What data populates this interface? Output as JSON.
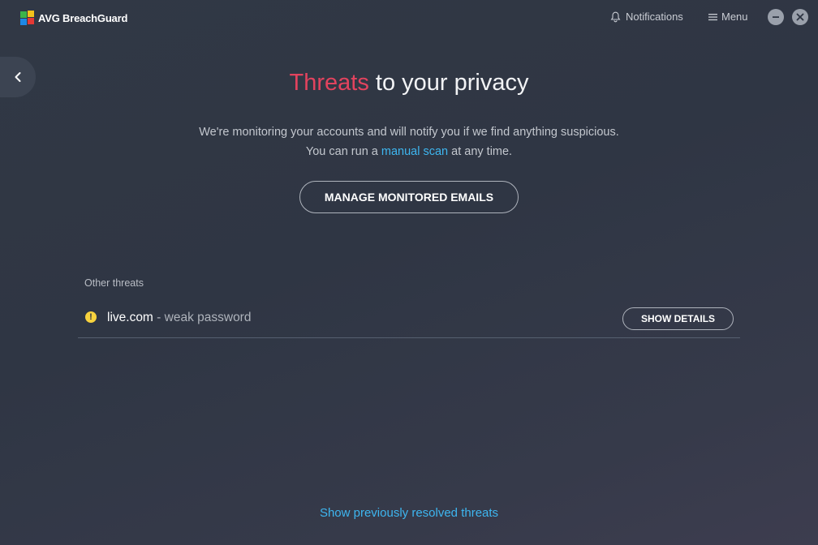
{
  "app": {
    "brand": "AVG",
    "product": "BreachGuard"
  },
  "titlebar": {
    "notifications_label": "Notifications",
    "menu_label": "Menu"
  },
  "main": {
    "title_accent": "Threats",
    "title_rest": " to your privacy",
    "description_line1": "We're monitoring your accounts and will notify you if we find anything suspicious.",
    "description_line2_prefix": "You can run a ",
    "description_link": "manual scan",
    "description_line2_suffix": " at any time.",
    "manage_button": "MANAGE MONITORED EMAILS"
  },
  "other_threats": {
    "section_label": "Other threats",
    "items": [
      {
        "site": "live.com",
        "separator": " - ",
        "issue": "weak password",
        "status_color": "#f7d23e",
        "action_label": "SHOW DETAILS"
      }
    ]
  },
  "footer": {
    "resolved_link": "Show previously resolved threats"
  },
  "colors": {
    "accent_red": "#e2435e",
    "link_blue": "#3eb6f0",
    "warning_yellow": "#f7d23e"
  },
  "icons": {
    "logo": "avg-logo-icon",
    "notifications": "bell-icon",
    "menu": "hamburger-icon",
    "minimize": "minimize-icon",
    "close": "close-icon",
    "back": "chevron-left-icon",
    "warning": "warning-icon"
  }
}
